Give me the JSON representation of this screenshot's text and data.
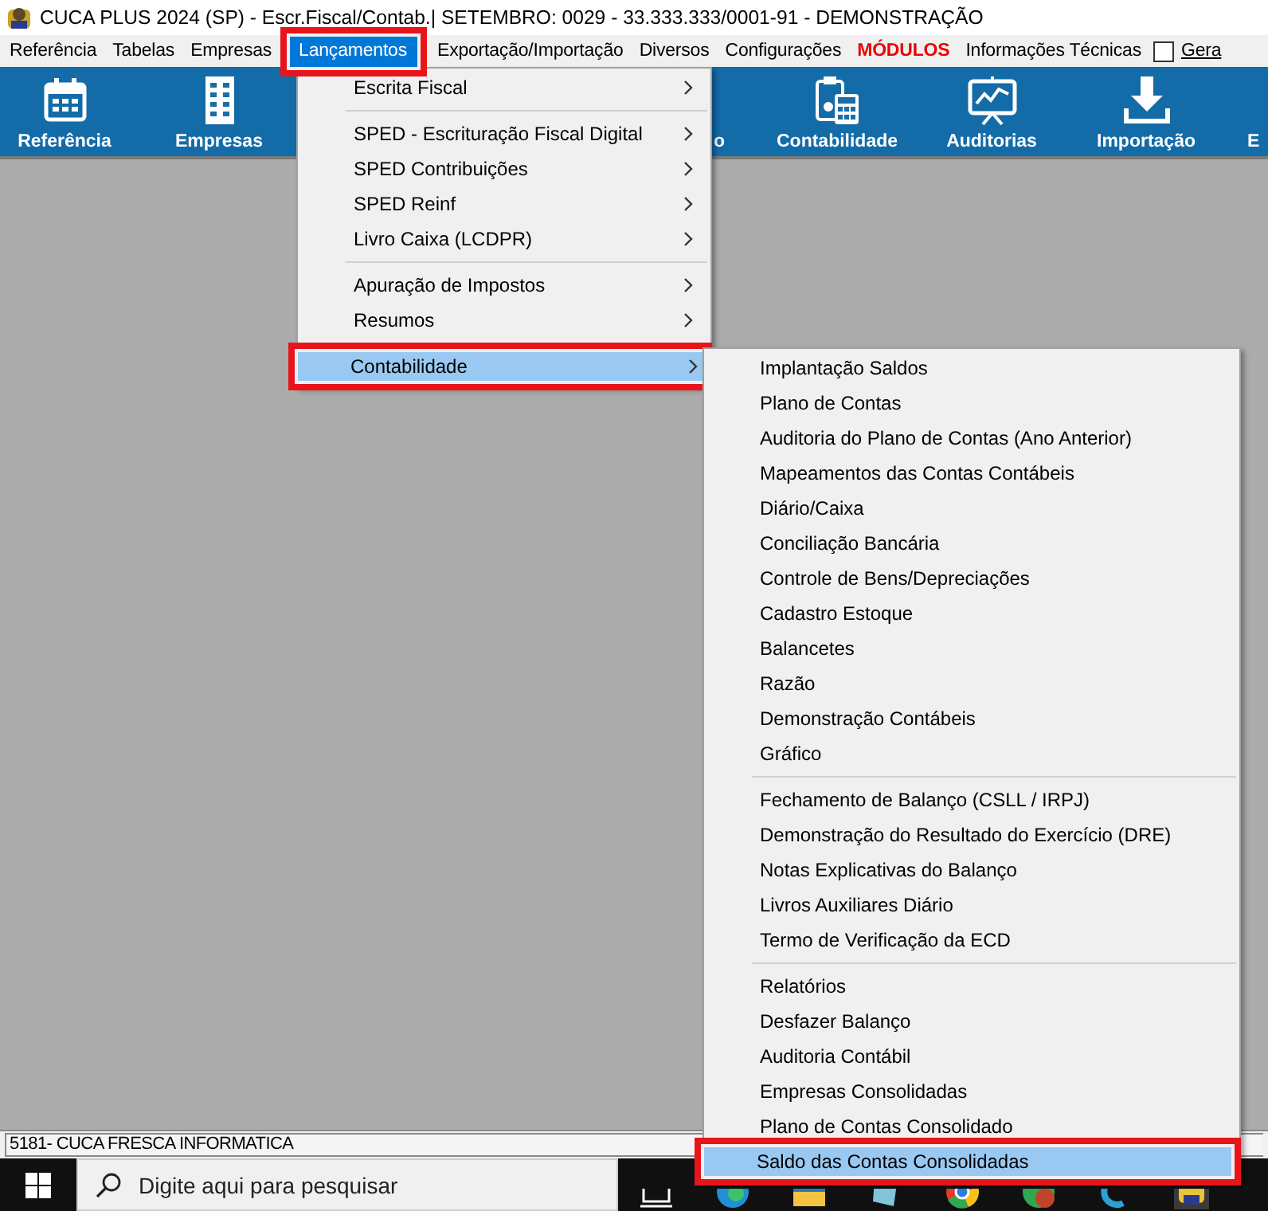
{
  "window": {
    "title": "CUCA PLUS 2024 (SP) - Escr.Fiscal/Contab.| SETEMBRO: 0029 - 33.333.333/0001-91 - DEMONSTRAÇÃO"
  },
  "menubar": [
    {
      "label": "Referência",
      "kind": "menu",
      "selected": false,
      "highlighted": false
    },
    {
      "label": "Tabelas",
      "kind": "menu",
      "selected": false,
      "highlighted": false
    },
    {
      "label": "Empresas",
      "kind": "menu",
      "selected": false,
      "highlighted": false
    },
    {
      "label": "Lançamentos",
      "kind": "menu",
      "selected": true,
      "highlighted": true
    },
    {
      "label": "Exportação/Importação",
      "kind": "menu",
      "selected": false,
      "highlighted": false
    },
    {
      "label": "Diversos",
      "kind": "menu",
      "selected": false,
      "highlighted": false
    },
    {
      "label": "Configurações",
      "kind": "menu",
      "selected": false,
      "highlighted": false
    },
    {
      "label": "MÓDULOS",
      "kind": "accent",
      "selected": false,
      "highlighted": false
    },
    {
      "label": "Informações Técnicas",
      "kind": "menu",
      "selected": false,
      "highlighted": false
    },
    {
      "label": "Gera",
      "kind": "checkbox",
      "checked": false
    }
  ],
  "toolbar": [
    {
      "label": "Referência"
    },
    {
      "label": "Empresas"
    },
    {
      "label": "o"
    },
    {
      "label": "Contabilidade"
    },
    {
      "label": "Auditorias"
    },
    {
      "label": "Importação"
    },
    {
      "label": "E"
    }
  ],
  "menu": {
    "groups": [
      [
        {
          "label": "Escrita Fiscal",
          "submenu": true,
          "selected": false,
          "highlighted": false
        }
      ],
      [
        {
          "label": "SPED - Escrituração Fiscal Digital",
          "submenu": true,
          "selected": false,
          "highlighted": false
        },
        {
          "label": "SPED Contribuições",
          "submenu": true,
          "selected": false,
          "highlighted": false
        },
        {
          "label": "SPED Reinf",
          "submenu": true,
          "selected": false,
          "highlighted": false
        },
        {
          "label": "Livro Caixa (LCDPR)",
          "submenu": true,
          "selected": false,
          "highlighted": false
        }
      ],
      [
        {
          "label": "Apuração de Impostos",
          "submenu": true,
          "selected": false,
          "highlighted": false
        },
        {
          "label": "Resumos",
          "submenu": true,
          "selected": false,
          "highlighted": false
        }
      ],
      [
        {
          "label": "Contabilidade",
          "submenu": true,
          "selected": true,
          "highlighted": true
        }
      ]
    ]
  },
  "submenu": {
    "groups": [
      [
        {
          "label": "Implantação Saldos",
          "selected": false,
          "highlighted": false
        },
        {
          "label": "Plano de Contas",
          "selected": false,
          "highlighted": false
        },
        {
          "label": "Auditoria do Plano de Contas (Ano Anterior)",
          "selected": false,
          "highlighted": false
        },
        {
          "label": "Mapeamentos das Contas Contábeis",
          "selected": false,
          "highlighted": false
        },
        {
          "label": "Diário/Caixa",
          "selected": false,
          "highlighted": false
        },
        {
          "label": "Conciliação Bancária",
          "selected": false,
          "highlighted": false
        },
        {
          "label": "Controle de Bens/Depreciações",
          "selected": false,
          "highlighted": false
        },
        {
          "label": "Cadastro Estoque",
          "selected": false,
          "highlighted": false
        },
        {
          "label": "Balancetes",
          "selected": false,
          "highlighted": false
        },
        {
          "label": "Razão",
          "selected": false,
          "highlighted": false
        },
        {
          "label": "Demonstração Contábeis",
          "selected": false,
          "highlighted": false
        },
        {
          "label": "Gráfico",
          "selected": false,
          "highlighted": false
        }
      ],
      [
        {
          "label": "Fechamento de Balanço (CSLL / IRPJ)",
          "selected": false,
          "highlighted": false
        },
        {
          "label": "Demonstração do Resultado do Exercício (DRE)",
          "selected": false,
          "highlighted": false
        },
        {
          "label": "Notas Explicativas do Balanço",
          "selected": false,
          "highlighted": false
        },
        {
          "label": "Livros Auxiliares Diário",
          "selected": false,
          "highlighted": false
        },
        {
          "label": "Termo de Verificação da ECD",
          "selected": false,
          "highlighted": false
        }
      ],
      [
        {
          "label": "Relatórios",
          "selected": false,
          "highlighted": false
        },
        {
          "label": "Desfazer Balanço",
          "selected": false,
          "highlighted": false
        },
        {
          "label": "Auditoria Contábil",
          "selected": false,
          "highlighted": false
        },
        {
          "label": "Empresas Consolidadas",
          "selected": false,
          "highlighted": false
        },
        {
          "label": "Plano de Contas Consolidado",
          "selected": false,
          "highlighted": false
        },
        {
          "label": "Saldo das Contas Consolidadas",
          "selected": true,
          "highlighted": true
        }
      ]
    ]
  },
  "status_bar": {
    "text": "5181- CUCA FRESCA INFORMATICA"
  },
  "taskbar": {
    "search": {
      "placeholder": "Digite aqui para pesquisar"
    }
  }
}
